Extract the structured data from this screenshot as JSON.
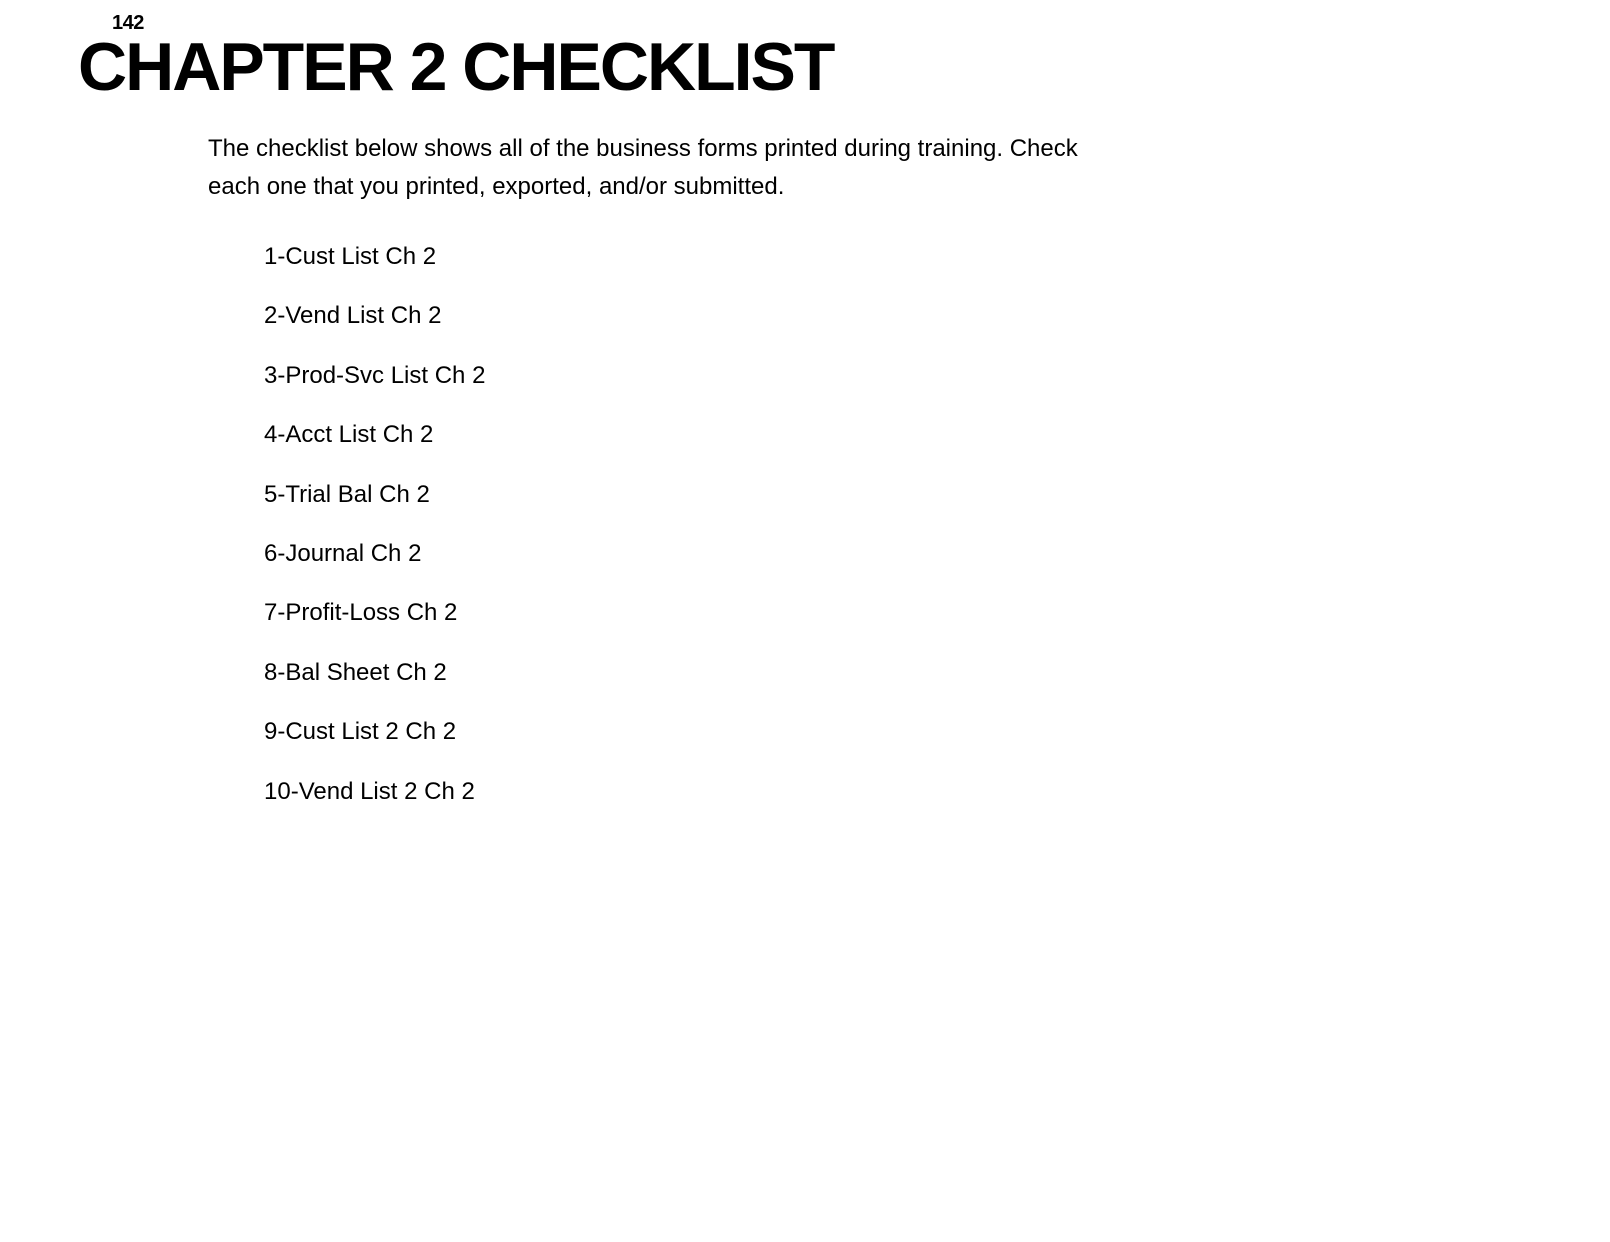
{
  "page_number": "142",
  "title": "CHAPTER 2 CHECKLIST",
  "intro": "The checklist below shows all of the business forms printed during training. Check each one that you printed, exported, and/or submitted.",
  "checklist": [
    "1-Cust List Ch 2",
    "2-Vend List Ch 2",
    "3-Prod-Svc List Ch 2",
    "4-Acct List Ch 2",
    "5-Trial Bal Ch 2",
    "6-Journal Ch 2",
    "7-Profit-Loss Ch 2",
    "8-Bal Sheet Ch 2",
    "9-Cust List 2 Ch 2",
    "10-Vend List 2 Ch 2"
  ]
}
